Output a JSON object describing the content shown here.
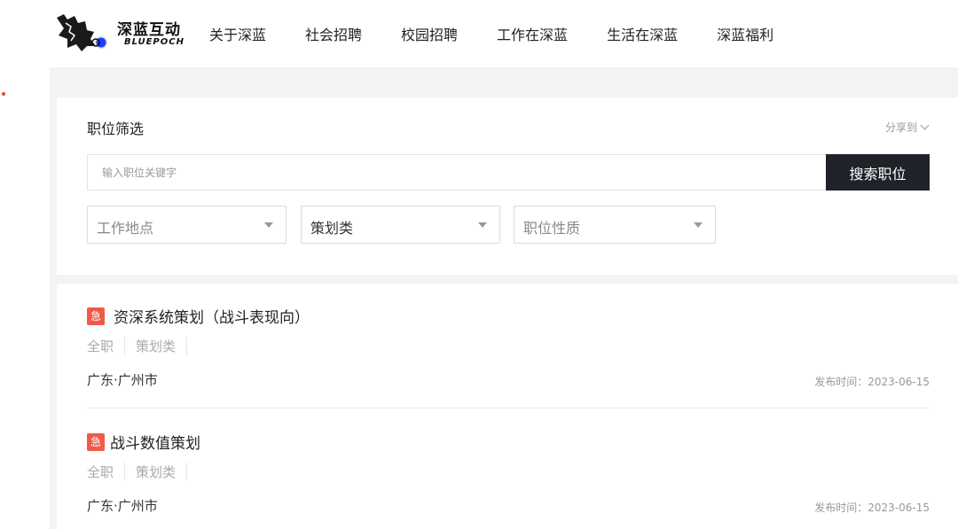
{
  "logo": {
    "cn": "深蓝互动",
    "en": "BLUEPOCH"
  },
  "nav": [
    {
      "label": "关于深蓝"
    },
    {
      "label": "社会招聘"
    },
    {
      "label": "校园招聘"
    },
    {
      "label": "工作在深蓝"
    },
    {
      "label": "生活在深蓝"
    },
    {
      "label": "深蓝福利"
    }
  ],
  "filter": {
    "title": "职位筛选",
    "share_label": "分享到",
    "search_placeholder": "输入职位关键字",
    "search_button": "搜索职位",
    "selects": [
      {
        "label": "工作地点",
        "is_placeholder": true
      },
      {
        "label": "策划类",
        "is_placeholder": false
      },
      {
        "label": "职位性质",
        "is_placeholder": true
      }
    ]
  },
  "jobs": [
    {
      "urgent": "急",
      "title": "资深系统策划（战斗表现向）",
      "tags": [
        "全职",
        "策划类"
      ],
      "location": "广东·广州市",
      "date": "发布时间：2023-06-15"
    },
    {
      "urgent": "急",
      "title": "战斗数值策划",
      "tags": [
        "全职",
        "策划类"
      ],
      "location": "广东·广州市",
      "date": "发布时间：2023-06-15"
    }
  ],
  "colors": {
    "urgent": "#f15a4a",
    "search_button": "#1f2329",
    "background": "#f3f3f3"
  }
}
